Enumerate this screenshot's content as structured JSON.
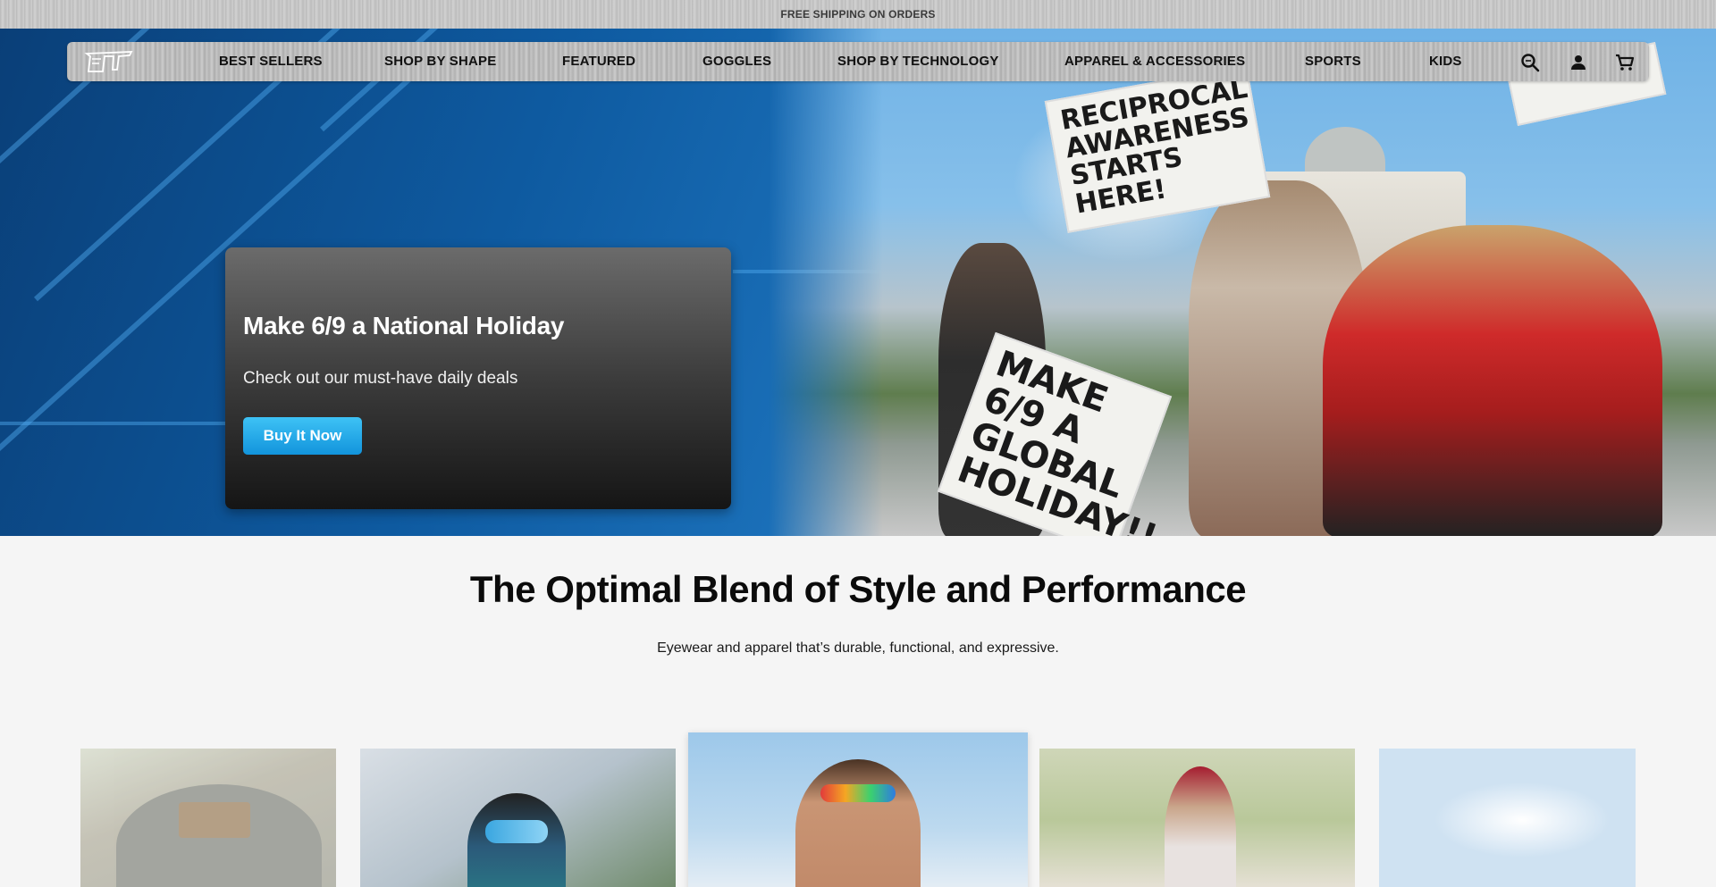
{
  "announcement": {
    "text": "FREE SHIPPING ON ORDERS"
  },
  "nav": {
    "items": [
      {
        "label": "BEST SELLERS"
      },
      {
        "label": "SHOP BY SHAPE"
      },
      {
        "label": "FEATURED"
      },
      {
        "label": "GOGGLES"
      },
      {
        "label": "SHOP BY TECHNOLOGY"
      },
      {
        "label": "APPAREL & ACCESSORIES"
      },
      {
        "label": "SPORTS"
      },
      {
        "label": "KIDS"
      }
    ],
    "icons": [
      "search-icon",
      "account-icon",
      "cart-icon"
    ]
  },
  "hero": {
    "title": "Make 6/9 a National Holiday",
    "subtitle": "Check out our must-have daily deals",
    "cta": "Buy It Now",
    "signs": {
      "sign1": "RECIPROCAL AWARENESS STARTS HERE!",
      "sign2": "MAKE 6/9 A GLOBAL HOLIDAY!!"
    }
  },
  "section": {
    "title": "The Optimal Blend of Style and Performance",
    "subtitle": "Eyewear and apparel that’s durable, functional, and expressive."
  },
  "colors": {
    "accent": "#1a9fe3",
    "hero_blue": "#0e5aa0",
    "card_dark": "#2a2a2a"
  }
}
